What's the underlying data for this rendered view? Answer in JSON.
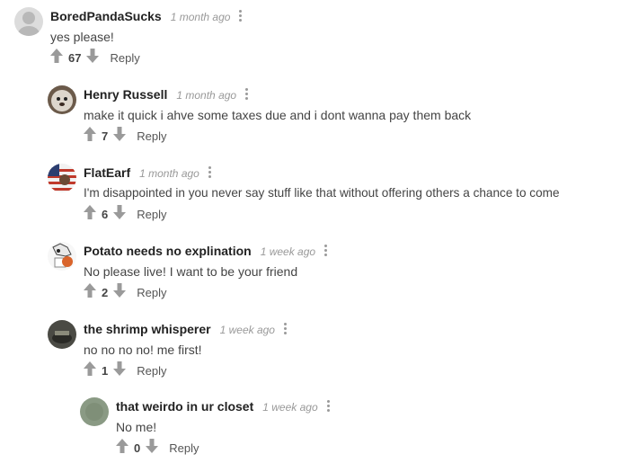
{
  "comments": [
    {
      "author": "BoredPandaSucks",
      "time": "1 month ago",
      "text": "yes please!",
      "votes": "67",
      "reply": "Reply",
      "avatar": "default-avatar"
    },
    {
      "author": "Henry Russell",
      "time": "1 month ago",
      "text": "make it quick i ahve some taxes due and i dont wanna pay them back",
      "votes": "7",
      "reply": "Reply",
      "avatar": "hedgehog-avatar"
    },
    {
      "author": "FlatEarf",
      "time": "1 month ago",
      "text": "I'm disappointed in you never say stuff like that without offering others a chance to come",
      "votes": "6",
      "reply": "Reply",
      "avatar": "flag-avatar"
    },
    {
      "author": "Potato needs no explination",
      "time": "1 week ago",
      "text": "No please live! I want to be your friend",
      "votes": "2",
      "reply": "Reply",
      "avatar": "cartoon-avatar"
    },
    {
      "author": "the shrimp whisperer",
      "time": "1 week ago",
      "text": "no no no no! me first!",
      "votes": "1",
      "reply": "Reply",
      "avatar": "dark-avatar"
    },
    {
      "author": "that weirdo in ur closet",
      "time": "1 week ago",
      "text": "No me!",
      "votes": "0",
      "reply": "Reply",
      "avatar": "green-avatar"
    }
  ],
  "colors": {
    "icon_gray": "#9a9a9a",
    "author": "#222222",
    "time": "#999999"
  }
}
